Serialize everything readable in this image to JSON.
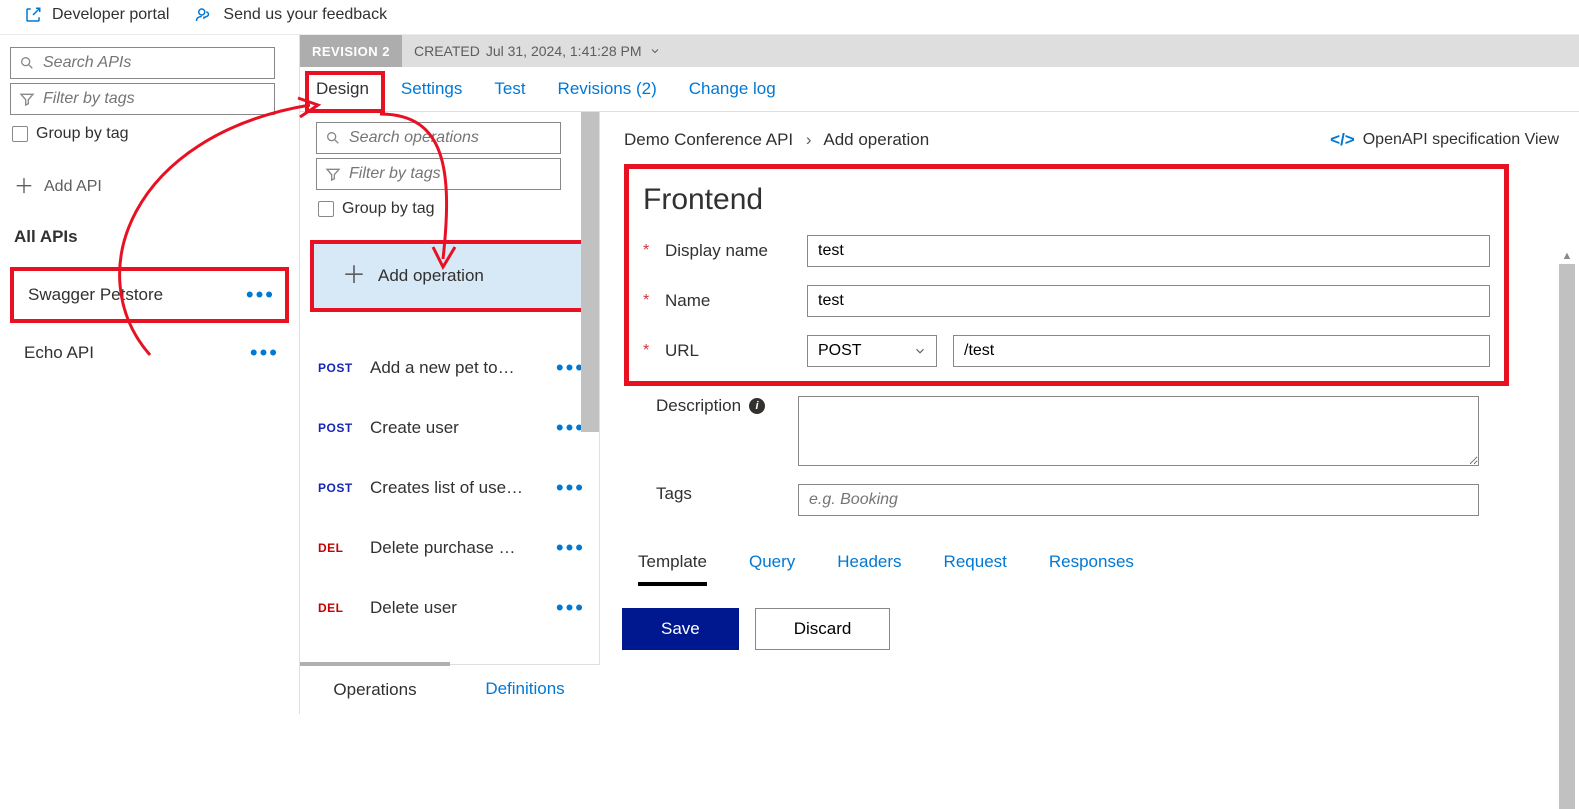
{
  "top": {
    "dev_portal": "Developer portal",
    "feedback": "Send us your feedback"
  },
  "left": {
    "search_placeholder": "Search APIs",
    "filter_placeholder": "Filter by tags",
    "group_by_tag": "Group by tag",
    "add_api": "Add API",
    "section": "All APIs",
    "apis": [
      {
        "name": "Swagger Petstore"
      },
      {
        "name": "Echo API"
      }
    ]
  },
  "revision": {
    "label": "REVISION 2",
    "created_prefix": "CREATED",
    "created_value": "Jul 31, 2024, 1:41:28 PM"
  },
  "tabs": {
    "design": "Design",
    "settings": "Settings",
    "test": "Test",
    "revisions": "Revisions (2)",
    "changelog": "Change log"
  },
  "ops": {
    "search_placeholder": "Search operations",
    "filter_placeholder": "Filter by tags",
    "group_by_tag": "Group by tag",
    "add_operation": "Add operation",
    "items": [
      {
        "method": "POST",
        "mclass": "post",
        "label": "Add a new pet to…"
      },
      {
        "method": "POST",
        "mclass": "post",
        "label": "Create user"
      },
      {
        "method": "POST",
        "mclass": "post",
        "label": "Creates list of use…"
      },
      {
        "method": "DEL",
        "mclass": "del",
        "label": "Delete purchase …"
      },
      {
        "method": "DEL",
        "mclass": "del",
        "label": "Delete user"
      }
    ],
    "bottom_tabs": {
      "operations": "Operations",
      "definitions": "Definitions"
    }
  },
  "breadcrumb": {
    "root": "Demo Conference API",
    "leaf": "Add operation"
  },
  "openapi_link": "OpenAPI specification View",
  "form": {
    "title": "Frontend",
    "display_name_label": "Display name",
    "display_name_value": "test",
    "name_label": "Name",
    "name_value": "test",
    "url_label": "URL",
    "url_method": "POST",
    "url_value": "/test",
    "description_label": "Description",
    "tags_label": "Tags",
    "tags_placeholder": "e.g. Booking"
  },
  "subtabs": {
    "template": "Template",
    "query": "Query",
    "headers": "Headers",
    "request": "Request",
    "responses": "Responses"
  },
  "buttons": {
    "save": "Save",
    "discard": "Discard"
  }
}
